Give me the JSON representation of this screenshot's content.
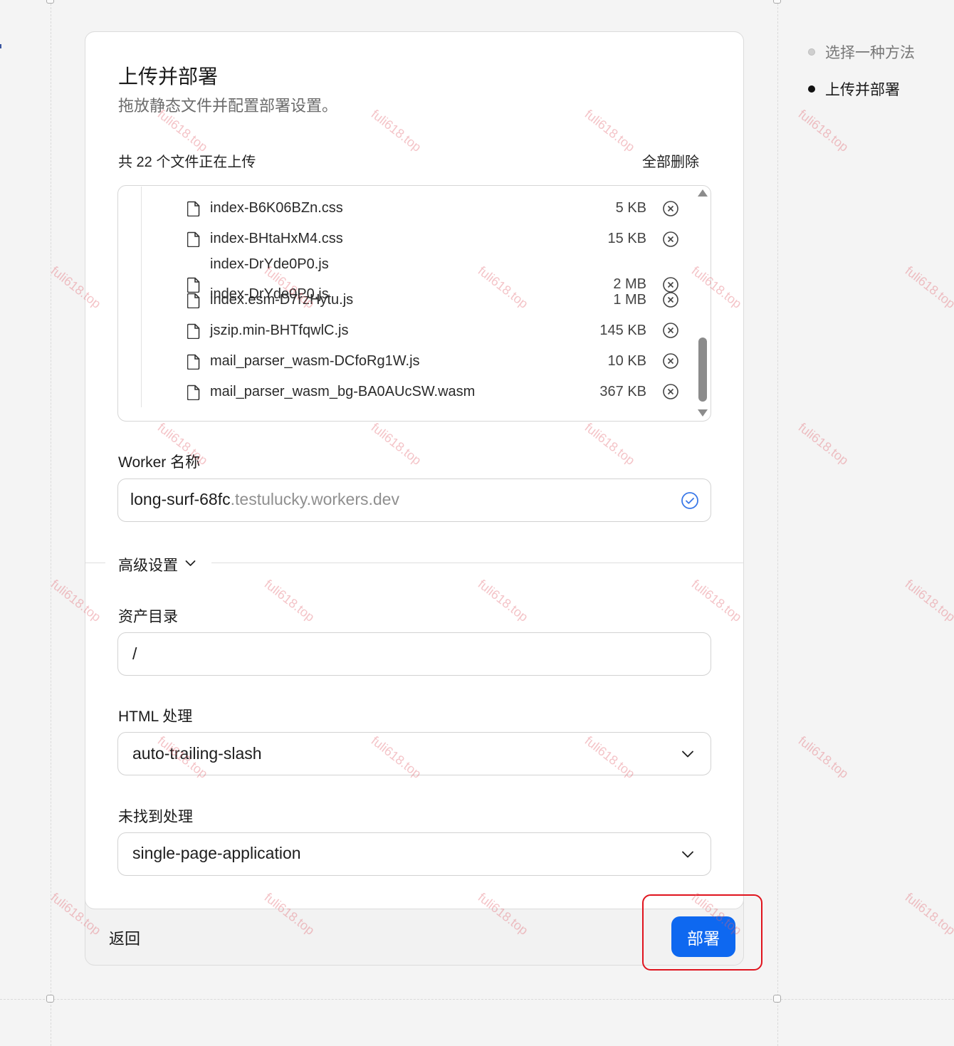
{
  "header": {
    "title": "上传并部署",
    "subtitle": "拖放静态文件并配置部署设置。"
  },
  "files": {
    "count_label": "共 22 个文件正在上传",
    "remove_all": "全部删除",
    "items": [
      {
        "name": "index-B6K06BZn.css",
        "size": "5 KB"
      },
      {
        "name": "index-BHtaHxM4.css",
        "size": "15 KB"
      },
      {
        "name": "index-DrYde0P0.js",
        "size": ""
      },
      {
        "name": "index-DrYde0P0.js",
        "size": "2 MB"
      },
      {
        "name": "index.esm-D7rzHytu.js",
        "size": "1 MB"
      },
      {
        "name": "jszip.min-BHTfqwlC.js",
        "size": "145 KB"
      },
      {
        "name": "mail_parser_wasm-DCfoRg1W.js",
        "size": "10 KB"
      },
      {
        "name": "mail_parser_wasm_bg-BA0AUcSW.wasm",
        "size": "367 KB"
      }
    ]
  },
  "worker": {
    "label": "Worker 名称",
    "name": "long-surf-68fc",
    "domain_suffix": ".testulucky.workers.dev"
  },
  "advanced": {
    "toggle_label": "高级设置",
    "assets_dir_label": "资产目录",
    "assets_dir_value": "/",
    "html_handling_label": "HTML 处理",
    "html_handling_value": "auto-trailing-slash",
    "not_found_label": "未找到处理",
    "not_found_value": "single-page-application"
  },
  "footer": {
    "back": "返回",
    "deploy": "部署"
  },
  "steps": [
    {
      "label": "选择一种方法",
      "state": "inactive"
    },
    {
      "label": "上传并部署",
      "state": "active"
    }
  ],
  "watermark": "fuli618.top",
  "colors": {
    "accent": "#0e68f0",
    "highlight": "#e0141e",
    "watermark": "#e2646e",
    "check": "#3a78e8"
  }
}
